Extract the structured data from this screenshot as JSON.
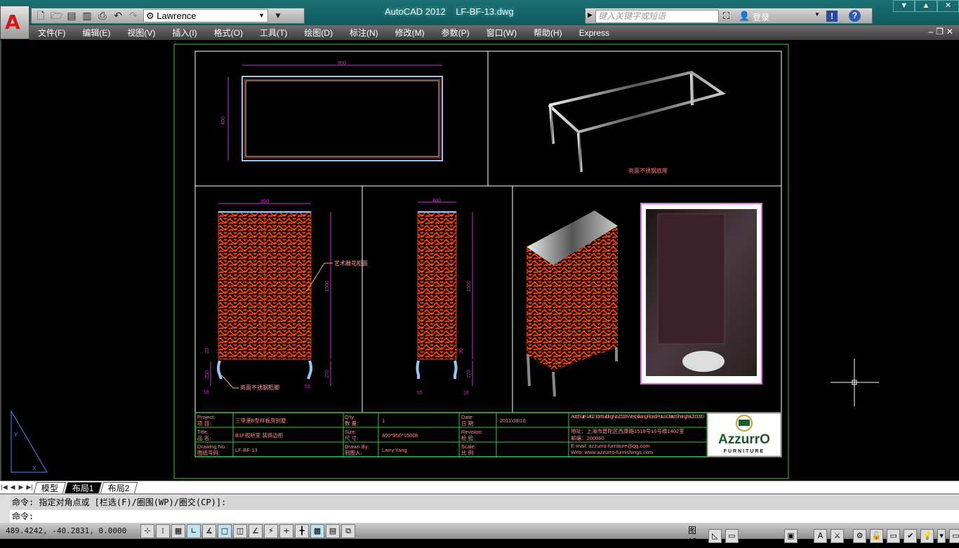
{
  "app": {
    "title": "AutoCAD 2012",
    "file": "LF-BF-13.dwg",
    "workspace": "Lawrence"
  },
  "quick_access": [
    {
      "icon": "new-icon"
    },
    {
      "icon": "open-icon"
    },
    {
      "icon": "save-icon"
    },
    {
      "icon": "save-as-icon"
    },
    {
      "icon": "print-icon"
    },
    {
      "icon": "undo-icon"
    },
    {
      "icon": "redo-icon"
    }
  ],
  "search": {
    "placeholder": "键入关键字或短语",
    "login": "登录"
  },
  "menu": [
    "文件(F)",
    "编辑(E)",
    "视图(V)",
    "插入(I)",
    "格式(O)",
    "工具(T)",
    "绘图(D)",
    "标注(N)",
    "修改(M)",
    "参数(P)",
    "窗口(W)",
    "帮助(H)",
    "Express"
  ],
  "drawing": {
    "plan": {
      "width_dim": "950",
      "depth_dim": "400"
    },
    "iso_base_label": "亮面不锈钢底座",
    "front": {
      "width_dim": "950",
      "height_dim": "1500",
      "leg_dim": "270",
      "d20": "20",
      "d250": "250",
      "d16": "16",
      "d55": "55",
      "label_panel": "艺术雕花柜面",
      "label_leg": "亮面不锈钢柜脚"
    },
    "side": {
      "width_dim": "400",
      "height_dim": "1500",
      "d30": "30",
      "d270": "270",
      "d55": "55",
      "d16": "16"
    },
    "colors": {
      "frame": "#3cc83c",
      "dimension": "#d030d0",
      "carving": "#ff4a10",
      "steel": "#9cc4f0"
    }
  },
  "title_block": {
    "project_label": "Project:\n项  目:",
    "project": "三甲港B型样板房别墅",
    "qty_label": "Q'ty:\n数  量:",
    "qty": "1",
    "date_label": "Date:\n日  期:",
    "date": "2011\\08\\16",
    "title_label": "Title:\n品  名:",
    "title": "B1F视听室    装饰边柜",
    "size_label": "Size:\n尺  寸:",
    "size": "400*950*1500h",
    "revision_label": "Revision:\n检  验:",
    "revision": "",
    "drawing_no_label": "Drawing No.:\n图纸号码:",
    "drawing_no": "LF-BF-13",
    "drawn_by_label": "Drawn By:\n制图人:",
    "drawn_by": "Larry.Yang",
    "scale_label": "Scale:\n比  例:",
    "scale": "",
    "address_en": "Add:Suite 1402 16# building No.1518 West Xikang Road Putuo District Shanghai 200060",
    "address_cn": "地址：上海市普陀区西康路1518号16号楼1402室",
    "postcode": "邮编：200060",
    "email": "E-mail: azzurro-furniture@qq.com",
    "web": "Web: www.azzurro-furnishings.com",
    "logo_text": "AzzurrO",
    "logo_sub": "FURNITURE"
  },
  "layout_tabs": [
    {
      "label": "模型",
      "active": false
    },
    {
      "label": "布局1",
      "active": true
    },
    {
      "label": "布局2",
      "active": false
    }
  ],
  "command": {
    "history": "命令: 指定对角点或 [栏选(F)/圈围(WP)/圈交(CP)]:",
    "prompt": "命令:"
  },
  "status": {
    "coords": "489.4242, -40.2831, 0.0000",
    "paper": "图纸"
  }
}
